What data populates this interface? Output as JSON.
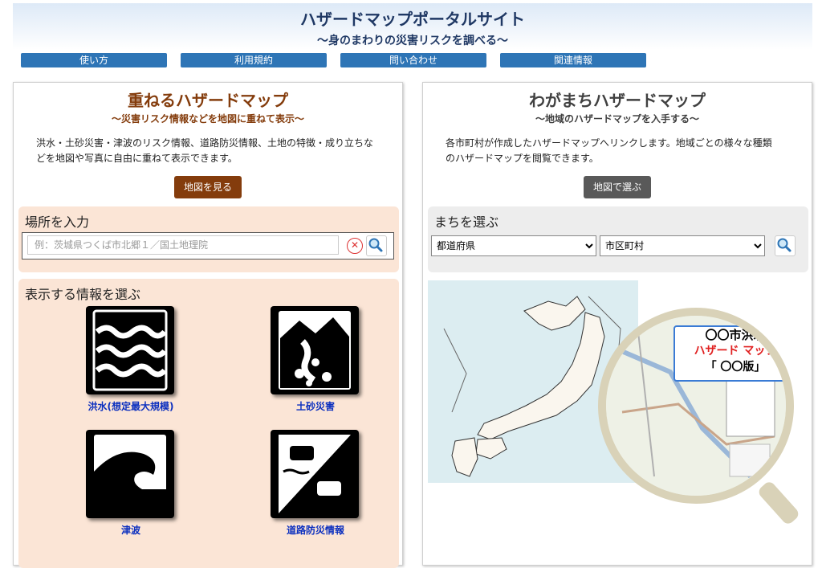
{
  "header": {
    "title": "ハザードマップポータルサイト",
    "subtitle": "～身のまわりの災害リスクを調べる～"
  },
  "nav": [
    {
      "label": "使い方"
    },
    {
      "label": "利用規約"
    },
    {
      "label": "問い合わせ"
    },
    {
      "label": "関連情報"
    }
  ],
  "left_panel": {
    "title": "重ねるハザードマップ",
    "subtitle": "～災害リスク情報などを地図に重ねて表示～",
    "description_lines": [
      "洪水・土砂災害・津波のリスク情報、道路防災情報、土地の特徴・成り立ちな",
      "どを地図や写真に自由に重ねて表示できます。"
    ],
    "view_map_button": "地図を見る",
    "search": {
      "heading": "場所を入力",
      "placeholder": "例：茨城県つくば市北郷１／国土地理院",
      "value": ""
    },
    "info": {
      "heading": "表示する情報を選ぶ",
      "items": [
        {
          "label": "洪水(想定最大規模)",
          "icon": "flood-icon"
        },
        {
          "label": "土砂災害",
          "icon": "landslide-icon"
        },
        {
          "label": "津波",
          "icon": "tsunami-icon"
        },
        {
          "label": "道路防災情報",
          "icon": "road-disaster-icon"
        }
      ]
    }
  },
  "right_panel": {
    "title": "わがまちハザードマップ",
    "subtitle": "～地域のハザードマップを入手する～",
    "description_lines": [
      "各市町村が作成したハザードマップへリンクします。地域ごとの様々な種類",
      "のハザードマップを閲覧できます。"
    ],
    "select_on_map_button": "地図で選ぶ",
    "town": {
      "heading": "まちを選ぶ",
      "prefecture": {
        "selected": "都道府県"
      },
      "municipality": {
        "selected": "市区町村"
      }
    },
    "magnifier_card": {
      "line1": "〇〇市洪水",
      "line2": "ハザード マップ",
      "line3": "「 〇〇版」"
    }
  },
  "colors": {
    "title_blue": "#1f3864",
    "nav_blue": "#2e75b6",
    "brown": "#843c0c",
    "peach_box": "#fbe5d6",
    "gray_button": "#595959",
    "gray_box": "#ededed",
    "link_blue": "#0b2fbf"
  }
}
